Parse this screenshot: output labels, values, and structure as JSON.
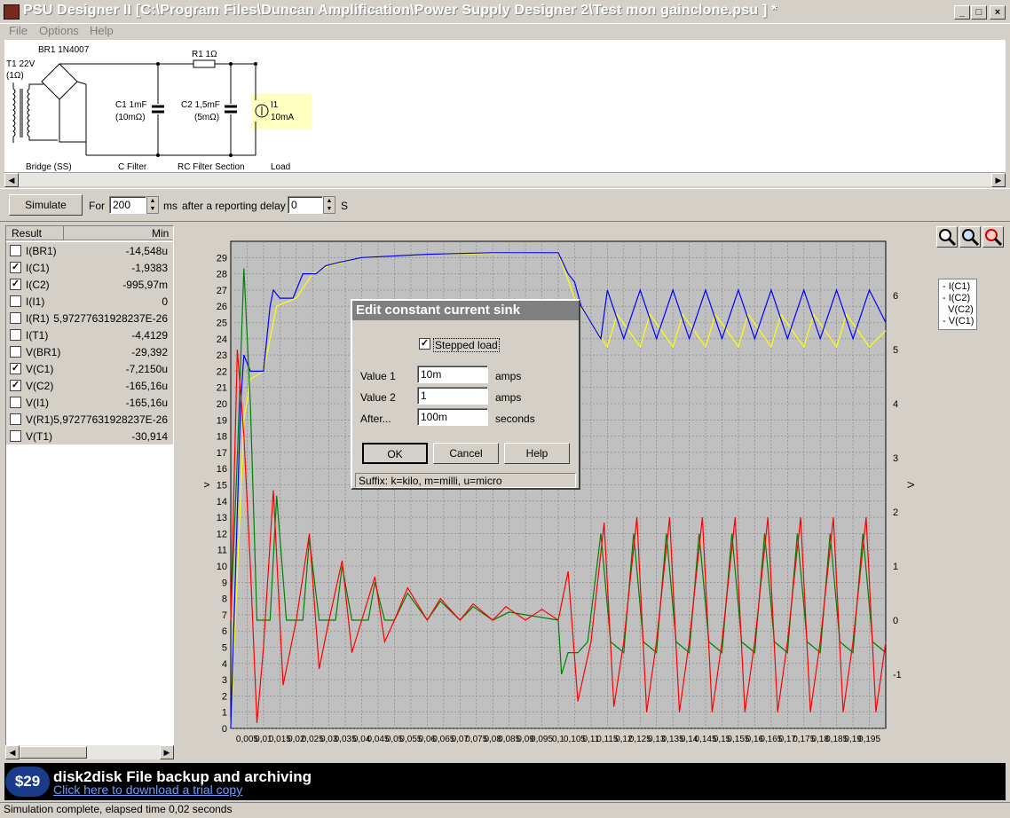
{
  "window": {
    "title": "PSU Designer II  [C:\\Program Files\\Duncan Amplification\\Power Supply Designer 2\\Test mon gainclone.psu ] *"
  },
  "menu": [
    {
      "label": "File"
    },
    {
      "label": "Options"
    },
    {
      "label": "Help"
    }
  ],
  "schematic": {
    "transformer": {
      "name": "T1 22V",
      "res": "(1Ω)"
    },
    "bridge": {
      "name": "BR1 1N4007",
      "section": "Bridge (SS)"
    },
    "c1": {
      "name": "C1 1mF",
      "res": "(10mΩ)",
      "section": "C Filter"
    },
    "r1": {
      "name": "R1 1Ω"
    },
    "c2": {
      "name": "C2 1,5mF",
      "res": "(5mΩ)",
      "section": "RC Filter Section"
    },
    "load": {
      "name": "I1",
      "value": "10mA",
      "section": "Load"
    }
  },
  "toolbar": {
    "simulate_label": "Simulate",
    "for_label": "For",
    "duration": "200",
    "ms_label": "ms",
    "delay_label": "after a reporting delay of",
    "delay": "0",
    "s_label": "S"
  },
  "results": {
    "col_result": "Result",
    "col_min": "Min",
    "rows": [
      {
        "name": "I(BR1)",
        "min": "-14,548u",
        "checked": false
      },
      {
        "name": "I(C1)",
        "min": "-1,9383",
        "checked": true
      },
      {
        "name": "I(C2)",
        "min": "-995,97m",
        "checked": true
      },
      {
        "name": "I(I1)",
        "min": "0",
        "checked": false
      },
      {
        "name": "I(R1)",
        "min": "5,97277631928237E-26",
        "checked": false
      },
      {
        "name": "I(T1)",
        "min": "-4,4129",
        "checked": false
      },
      {
        "name": "V(BR1)",
        "min": "-29,392",
        "checked": false
      },
      {
        "name": "V(C1)",
        "min": "-7,2150u",
        "checked": true
      },
      {
        "name": "V(C2)",
        "min": "-165,16u",
        "checked": true
      },
      {
        "name": "V(I1)",
        "min": "-165,16u",
        "checked": false
      },
      {
        "name": "V(R1)",
        "min": "5,97277631928237E-26",
        "checked": false
      },
      {
        "name": "V(T1)",
        "min": "-30,914",
        "checked": false
      }
    ]
  },
  "chart_data": {
    "type": "line",
    "ylabel": "V",
    "y2label": "V",
    "ylim": [
      0,
      30
    ],
    "y2lim": [
      -2,
      7
    ],
    "xlim": [
      0,
      0.2
    ],
    "yticks": [
      "0",
      "1",
      "2",
      "3",
      "4",
      "5",
      "6",
      "7",
      "8",
      "9",
      "10",
      "11",
      "12",
      "13",
      "14",
      "15",
      "16",
      "17",
      "18",
      "19",
      "20",
      "21",
      "22",
      "23",
      "24",
      "25",
      "26",
      "27",
      "28",
      "29"
    ],
    "y2ticks": [
      "-1",
      "0",
      "1",
      "2",
      "3",
      "4",
      "5",
      "6"
    ],
    "xticks": [
      "0,005",
      "0,01",
      "0,015",
      "0,02",
      "0,025",
      "0,03",
      "0,035",
      "0,04",
      "0,045",
      "0,05",
      "0,055",
      "0,06",
      "0,065",
      "0,07",
      "0,075",
      "0,08",
      "0,085",
      "0,09",
      "0,095",
      "0,1",
      "0,105",
      "0,11",
      "0,115",
      "0,12",
      "0,125",
      "0,13",
      "0,135",
      "0,14",
      "0,145",
      "0,15",
      "0,155",
      "0,16",
      "0,165",
      "0,17",
      "0,175",
      "0,18",
      "0,185",
      "0,19",
      "0,195"
    ],
    "grid": true,
    "legend_position": "right",
    "series": [
      {
        "name": "V(C1)",
        "axis": "left",
        "color": "#0000ff",
        "description_points": [
          [
            0,
            0
          ],
          [
            0.003,
            20
          ],
          [
            0.004,
            23
          ],
          [
            0.006,
            22
          ],
          [
            0.01,
            22
          ],
          [
            0.012,
            26
          ],
          [
            0.013,
            27
          ],
          [
            0.015,
            26.5
          ],
          [
            0.019,
            26.5
          ],
          [
            0.022,
            28
          ],
          [
            0.026,
            28
          ],
          [
            0.029,
            28.5
          ],
          [
            0.033,
            28.7
          ],
          [
            0.04,
            29
          ],
          [
            0.05,
            29.1
          ],
          [
            0.06,
            29.2
          ],
          [
            0.08,
            29.3
          ],
          [
            0.1,
            29.3
          ],
          [
            0.103,
            28
          ],
          [
            0.105,
            27.5
          ],
          [
            0.107,
            26
          ],
          [
            0.11,
            25
          ],
          [
            0.113,
            24
          ],
          [
            0.115,
            27
          ],
          [
            0.12,
            24
          ],
          [
            0.125,
            27
          ],
          [
            0.13,
            24
          ],
          [
            0.135,
            27
          ],
          [
            0.14,
            24
          ],
          [
            0.145,
            27
          ],
          [
            0.15,
            24
          ],
          [
            0.155,
            27
          ],
          [
            0.16,
            24
          ],
          [
            0.165,
            27
          ],
          [
            0.17,
            24
          ],
          [
            0.175,
            27
          ],
          [
            0.18,
            24
          ],
          [
            0.185,
            27
          ],
          [
            0.19,
            24
          ],
          [
            0.195,
            27
          ],
          [
            0.2,
            25
          ]
        ]
      },
      {
        "name": "V(C2)",
        "axis": "left",
        "color": "#ffff00",
        "description_points": [
          [
            0,
            0
          ],
          [
            0.004,
            19
          ],
          [
            0.006,
            21.5
          ],
          [
            0.01,
            22
          ],
          [
            0.014,
            26
          ],
          [
            0.02,
            26.5
          ],
          [
            0.025,
            28
          ],
          [
            0.03,
            28.5
          ],
          [
            0.04,
            29
          ],
          [
            0.06,
            29.2
          ],
          [
            0.1,
            29.3
          ],
          [
            0.105,
            26.5
          ],
          [
            0.11,
            25
          ],
          [
            0.115,
            23.5
          ],
          [
            0.118,
            25.5
          ],
          [
            0.125,
            23.5
          ],
          [
            0.128,
            25.5
          ],
          [
            0.135,
            23.5
          ],
          [
            0.138,
            25.5
          ],
          [
            0.145,
            23.5
          ],
          [
            0.148,
            25.5
          ],
          [
            0.155,
            23.5
          ],
          [
            0.158,
            25.5
          ],
          [
            0.165,
            23.5
          ],
          [
            0.168,
            25.5
          ],
          [
            0.175,
            23.5
          ],
          [
            0.178,
            25.5
          ],
          [
            0.185,
            23.5
          ],
          [
            0.188,
            25.5
          ],
          [
            0.195,
            23.5
          ],
          [
            0.2,
            24.5
          ]
        ]
      },
      {
        "name": "I(C1)",
        "axis": "right",
        "color": "#ff0000",
        "description_points": [
          [
            0,
            0
          ],
          [
            0.002,
            5
          ],
          [
            0.004,
            3.4
          ],
          [
            0.006,
            1
          ],
          [
            0.008,
            -1.9
          ],
          [
            0.01,
            -0.5
          ],
          [
            0.013,
            2.4
          ],
          [
            0.016,
            -1.2
          ],
          [
            0.02,
            0
          ],
          [
            0.024,
            1.6
          ],
          [
            0.027,
            -0.9
          ],
          [
            0.03,
            0
          ],
          [
            0.034,
            1.1
          ],
          [
            0.037,
            -0.6
          ],
          [
            0.04,
            0
          ],
          [
            0.044,
            0.8
          ],
          [
            0.047,
            -0.4
          ],
          [
            0.05,
            0
          ],
          [
            0.054,
            0.6
          ],
          [
            0.06,
            0
          ],
          [
            0.064,
            0.4
          ],
          [
            0.07,
            0
          ],
          [
            0.074,
            0.3
          ],
          [
            0.08,
            0
          ],
          [
            0.084,
            0.25
          ],
          [
            0.09,
            0
          ],
          [
            0.095,
            0.2
          ],
          [
            0.1,
            0
          ],
          [
            0.103,
            0.9
          ],
          [
            0.106,
            -1.5
          ],
          [
            0.11,
            -0.4
          ],
          [
            0.114,
            1.8
          ],
          [
            0.117,
            -1.6
          ],
          [
            0.12,
            -0.4
          ],
          [
            0.124,
            1.9
          ],
          [
            0.127,
            -1.7
          ],
          [
            0.13,
            -0.4
          ],
          [
            0.134,
            1.9
          ],
          [
            0.137,
            -1.7
          ],
          [
            0.14,
            -0.4
          ],
          [
            0.144,
            1.9
          ],
          [
            0.147,
            -1.7
          ],
          [
            0.15,
            -0.4
          ],
          [
            0.154,
            1.9
          ],
          [
            0.157,
            -1.7
          ],
          [
            0.16,
            -0.4
          ],
          [
            0.164,
            1.9
          ],
          [
            0.167,
            -1.7
          ],
          [
            0.17,
            -0.4
          ],
          [
            0.174,
            1.9
          ],
          [
            0.177,
            -1.7
          ],
          [
            0.18,
            -0.4
          ],
          [
            0.184,
            1.9
          ],
          [
            0.187,
            -1.7
          ],
          [
            0.19,
            -0.4
          ],
          [
            0.194,
            1.9
          ],
          [
            0.197,
            -1.7
          ],
          [
            0.2,
            -0.4
          ]
        ]
      },
      {
        "name": "I(C2)",
        "axis": "right",
        "color": "#008000",
        "description_points": [
          [
            0,
            0
          ],
          [
            0.002,
            3
          ],
          [
            0.004,
            6.5
          ],
          [
            0.006,
            4
          ],
          [
            0.008,
            0
          ],
          [
            0.012,
            0
          ],
          [
            0.014,
            2.3
          ],
          [
            0.017,
            0
          ],
          [
            0.022,
            0
          ],
          [
            0.024,
            1.5
          ],
          [
            0.027,
            0
          ],
          [
            0.032,
            0
          ],
          [
            0.034,
            1
          ],
          [
            0.037,
            0
          ],
          [
            0.042,
            0
          ],
          [
            0.044,
            0.7
          ],
          [
            0.047,
            0
          ],
          [
            0.05,
            0
          ],
          [
            0.054,
            0.5
          ],
          [
            0.06,
            0
          ],
          [
            0.064,
            0.35
          ],
          [
            0.07,
            0
          ],
          [
            0.074,
            0.25
          ],
          [
            0.08,
            0
          ],
          [
            0.085,
            0.15
          ],
          [
            0.1,
            0
          ],
          [
            0.101,
            -1
          ],
          [
            0.103,
            -0.6
          ],
          [
            0.106,
            -0.6
          ],
          [
            0.109,
            -0.4
          ],
          [
            0.113,
            1.6
          ],
          [
            0.116,
            -0.4
          ],
          [
            0.12,
            -0.6
          ],
          [
            0.123,
            1.6
          ],
          [
            0.126,
            -0.4
          ],
          [
            0.13,
            -0.6
          ],
          [
            0.133,
            1.6
          ],
          [
            0.136,
            -0.4
          ],
          [
            0.14,
            -0.6
          ],
          [
            0.143,
            1.6
          ],
          [
            0.146,
            -0.4
          ],
          [
            0.15,
            -0.6
          ],
          [
            0.153,
            1.6
          ],
          [
            0.156,
            -0.4
          ],
          [
            0.16,
            -0.6
          ],
          [
            0.163,
            1.6
          ],
          [
            0.166,
            -0.4
          ],
          [
            0.17,
            -0.6
          ],
          [
            0.173,
            1.6
          ],
          [
            0.176,
            -0.4
          ],
          [
            0.18,
            -0.6
          ],
          [
            0.183,
            1.6
          ],
          [
            0.186,
            -0.4
          ],
          [
            0.19,
            -0.6
          ],
          [
            0.193,
            1.6
          ],
          [
            0.196,
            -0.4
          ],
          [
            0.2,
            -0.6
          ]
        ]
      }
    ]
  },
  "legend": [
    {
      "label": "I(C1)"
    },
    {
      "label": "I(C2)"
    },
    {
      "label": "V(C2)"
    },
    {
      "label": "V(C1)"
    }
  ],
  "dialog": {
    "title": "Edit constant current sink",
    "stepped_label": "Stepped load",
    "stepped_checked": true,
    "value1_label": "Value 1",
    "value1": "10m",
    "value1_unit": "amps",
    "value2_label": "Value 2",
    "value2": "1",
    "value2_unit": "amps",
    "after_label": "After...",
    "after": "100m",
    "after_unit": "seconds",
    "ok": "OK",
    "cancel": "Cancel",
    "help": "Help",
    "status": "Suffix: k=kilo, m=milli, u=micro"
  },
  "ad": {
    "price": "$29",
    "title": "disk2disk File backup and archiving",
    "link": "Click here to download a trial copy"
  },
  "status": {
    "text": "Simulation complete, elapsed time 0,02 seconds"
  },
  "colors": {
    "title_text": "#ffffff",
    "dialog_title_bg": "#808080",
    "chart_bg": "#c0c0c0",
    "load_highlight": "#ffffc0"
  }
}
